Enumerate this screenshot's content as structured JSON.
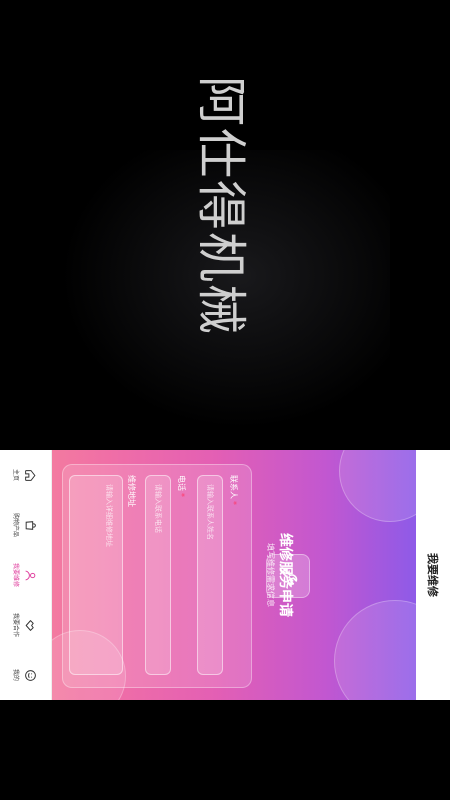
{
  "brand": {
    "title": "阿仕得机械"
  },
  "app": {
    "header_title": "我要维修",
    "form": {
      "title": "维修服务申请",
      "subtitle": "填写维修需求信息",
      "fields": [
        {
          "label": "联系人",
          "required": true,
          "placeholder": "请输入联系人姓名"
        },
        {
          "label": "电话",
          "required": true,
          "placeholder": "请输入联系电话"
        },
        {
          "label": "维修地址",
          "required": false,
          "placeholder": "请输入详细维修地址"
        }
      ]
    },
    "tabs": [
      {
        "label": "主页",
        "icon": "home-icon",
        "active": false
      },
      {
        "label": "购物产品",
        "icon": "bag-icon",
        "active": false
      },
      {
        "label": "我要维修",
        "icon": "user-wrench-icon",
        "active": true
      },
      {
        "label": "我要合作",
        "icon": "handshake-icon",
        "active": false
      },
      {
        "label": "我的",
        "icon": "smile-icon",
        "active": false
      }
    ]
  },
  "colors": {
    "gradient_top": "#8e5ae8",
    "gradient_bottom": "#f37aa0",
    "active_tab": "#e0409f"
  }
}
